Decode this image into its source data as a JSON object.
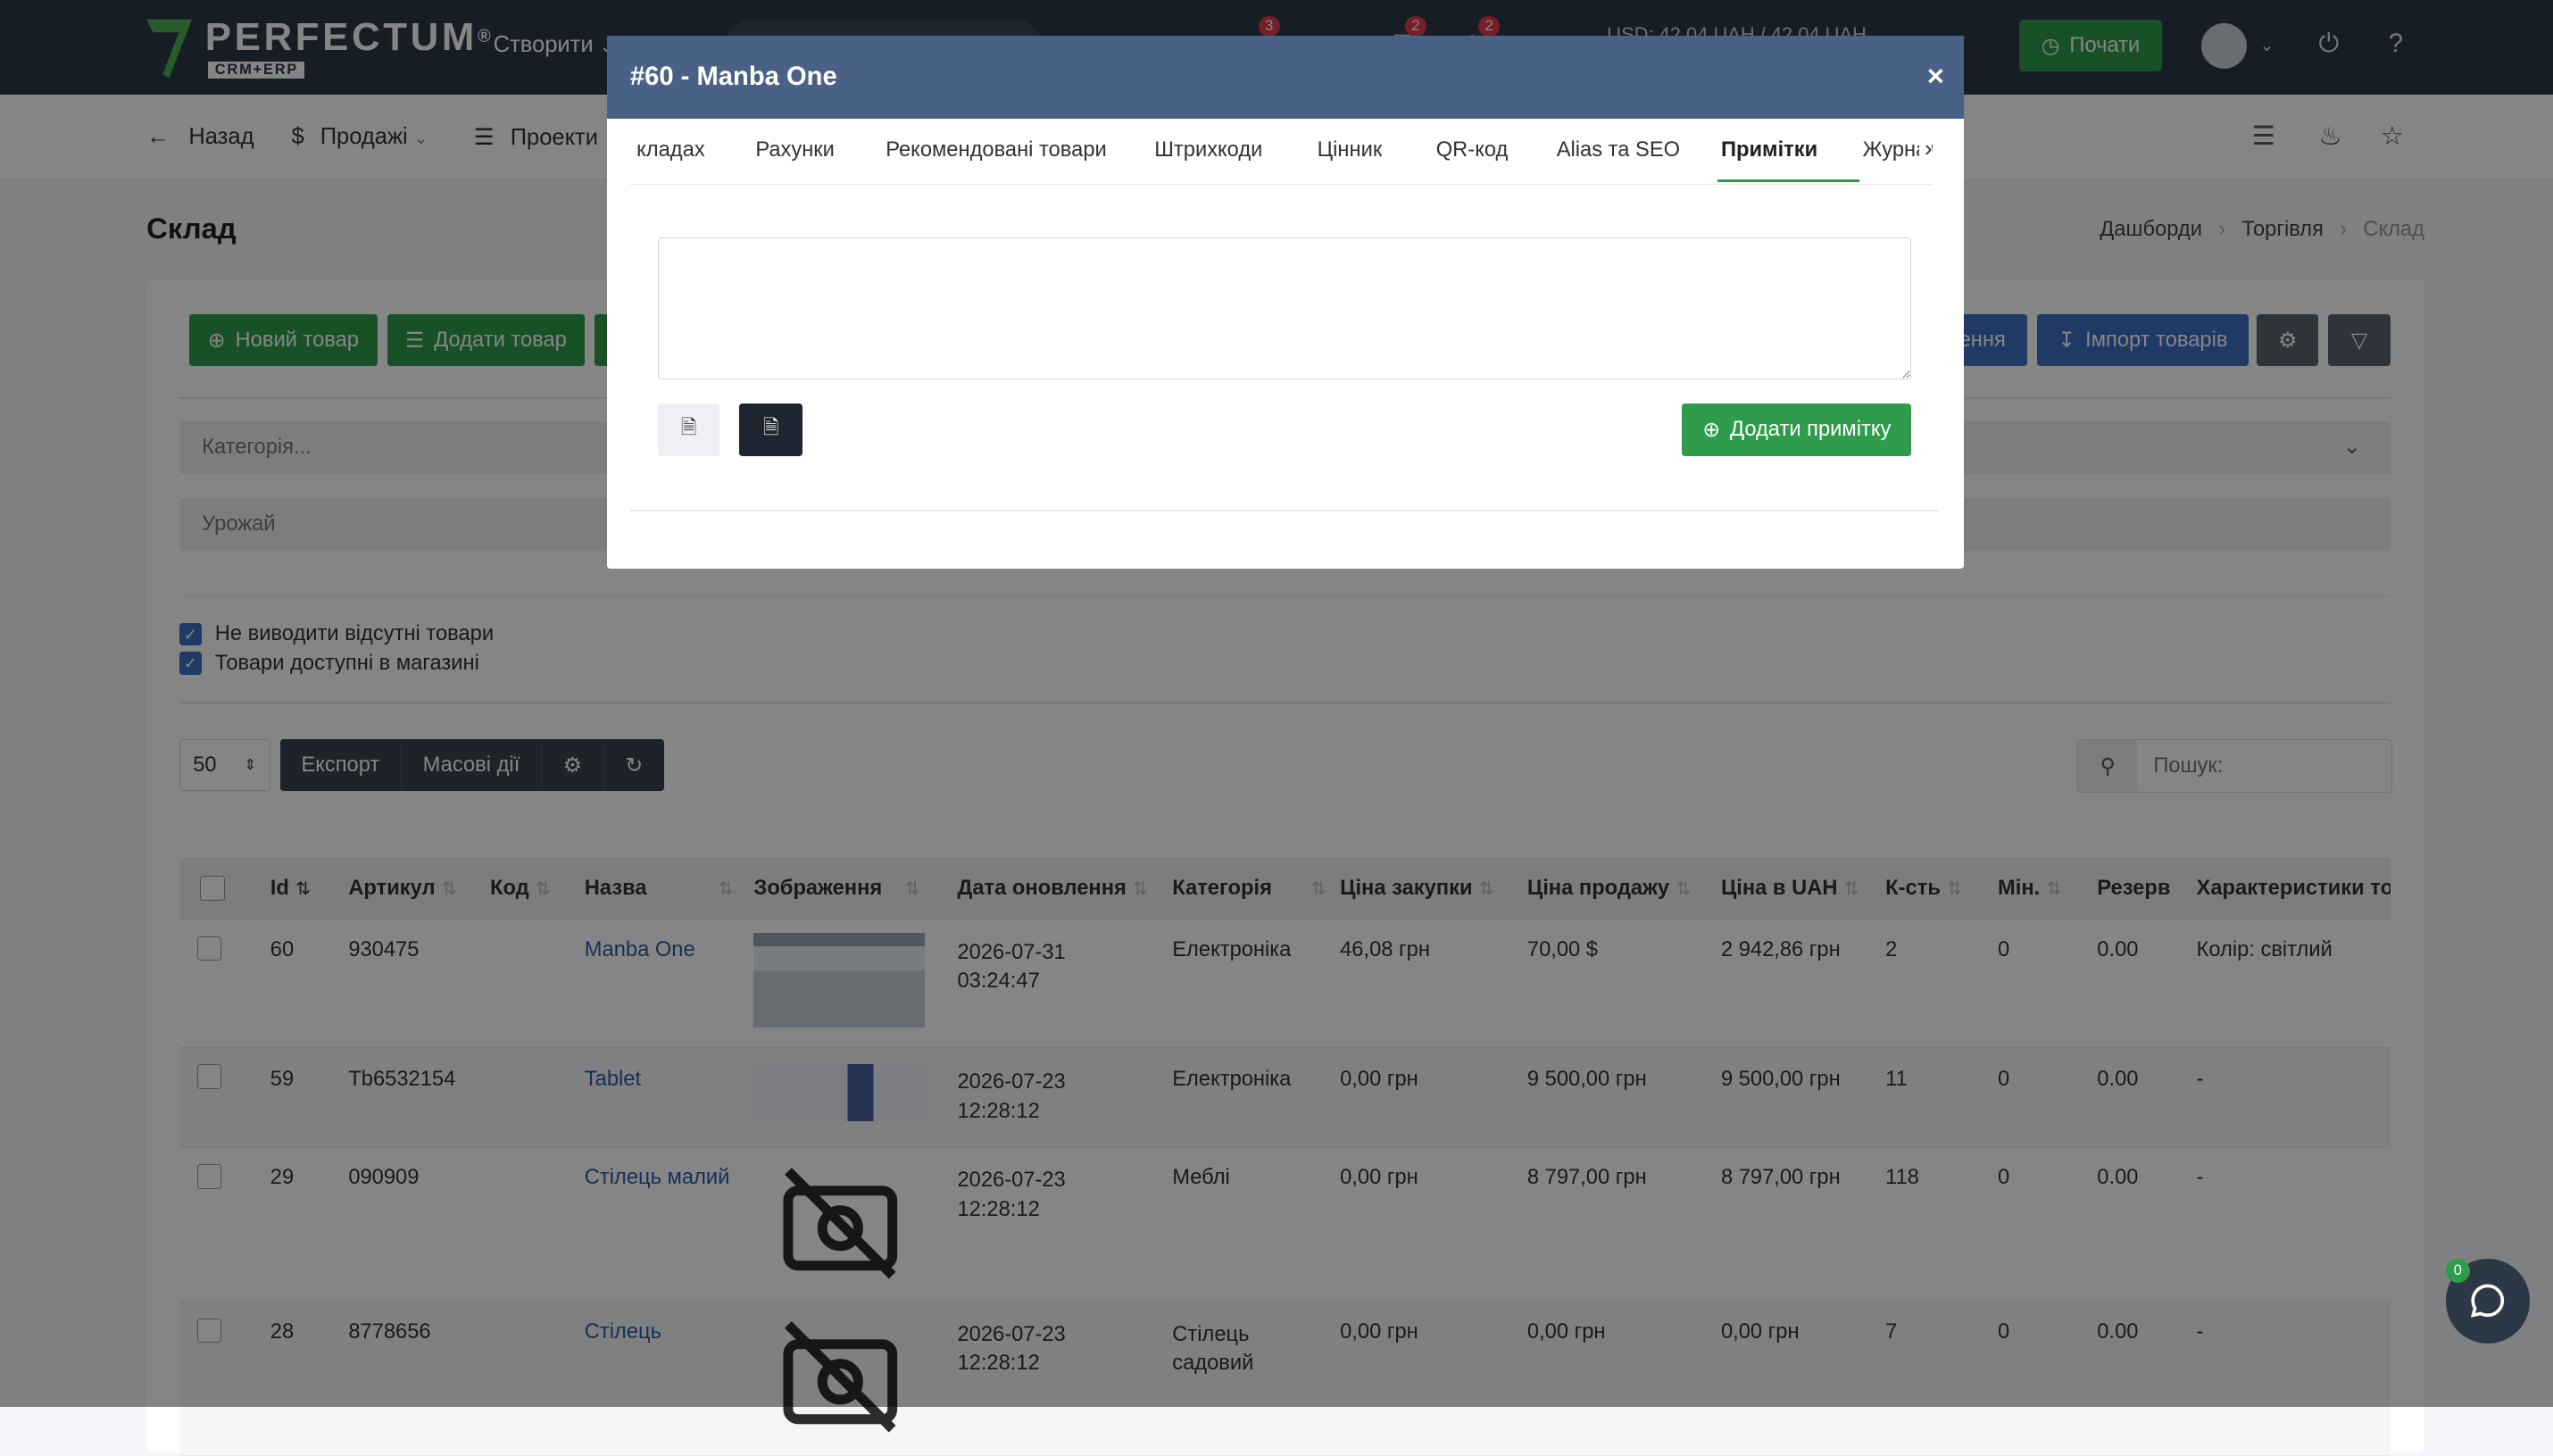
{
  "header": {
    "logo": "PERFECTUM",
    "logo_reg": "®",
    "logo_sub": "CRM+ERP",
    "create_menu": "Створити",
    "rates": "USD: 42,04 UAH / 42,04 UAH",
    "badges": [
      "3",
      "2",
      "2"
    ],
    "start_button": "Почати"
  },
  "subnav": {
    "back": "Назад",
    "sales": "Продажі",
    "projects": "Проекти"
  },
  "page": {
    "title": "Склад",
    "breadcrumb": [
      "Дашборди",
      "Торгівля",
      "Склад"
    ]
  },
  "actions": {
    "new_product": "Новий товар",
    "add_product": "Додати товар",
    "update_partial": "ення",
    "import_products": "Імпорт товарів"
  },
  "filters": {
    "category_placeholder": "Категорія...",
    "harvest_placeholder": "Урожай",
    "hide_missing": "Не виводити відсутні товари",
    "available_in_store": "Товари доступні в магазині"
  },
  "toolbar": {
    "per_page": "50",
    "export": "Експорт",
    "bulk_actions": "Масові дії",
    "search_placeholder": "Пошук:"
  },
  "table": {
    "columns": [
      "Id",
      "Артикул",
      "Код",
      "Назва",
      "Зображення",
      "Дата оновлення",
      "Категорія",
      "Ціна закупки",
      "Ціна продажу",
      "Ціна в UAH",
      "К-сть",
      "Мін.",
      "Резерв",
      "Характеристики тов"
    ],
    "rows": [
      {
        "id": "60",
        "sku": "930475",
        "code": "",
        "name": "Manba One",
        "date": "2026-07-31",
        "time": "03:24:47",
        "category": "Електроніка",
        "category2": "",
        "purchase": "46,08 грн",
        "sale": "70,00 $",
        "uah": "2 942,86 грн",
        "qty": "2",
        "min": "0",
        "reserve": "0.00",
        "chars": "Колір: світлий"
      },
      {
        "id": "59",
        "sku": "Tb6532154",
        "code": "",
        "name": "Tablet",
        "date": "2026-07-23",
        "time": "12:28:12",
        "category": "Електроніка",
        "category2": "",
        "purchase": "0,00 грн",
        "sale": "9 500,00 грн",
        "uah": "9 500,00 грн",
        "qty": "11",
        "min": "0",
        "reserve": "0.00",
        "chars": "-"
      },
      {
        "id": "29",
        "sku": "090909",
        "code": "",
        "name": "Стілець малий",
        "date": "2026-07-23",
        "time": "12:28:12",
        "category": "Меблі",
        "category2": "",
        "purchase": "0,00 грн",
        "sale": "8 797,00 грн",
        "uah": "8 797,00 грн",
        "qty": "118",
        "min": "0",
        "reserve": "0.00",
        "chars": "-"
      },
      {
        "id": "28",
        "sku": "8778656",
        "code": "",
        "name": "Стілець",
        "date": "2026-07-23",
        "time": "12:28:12",
        "category": "Стілець",
        "category2": "садовий",
        "purchase": "0,00 грн",
        "sale": "0,00 грн",
        "uah": "0,00 грн",
        "qty": "7",
        "min": "0",
        "reserve": "0.00",
        "chars": "-"
      }
    ]
  },
  "modal": {
    "title": "#60 - Manba One",
    "close": "×",
    "tabs": [
      "кладах",
      "Рахунки",
      "Рекомендовані товари",
      "Штрихкоди",
      "Цінник",
      "QR-код",
      "Alias та SEO",
      "Примітки",
      "Журнал"
    ],
    "active_tab": "Примітки",
    "add_note": "Додати примітку"
  },
  "chat": {
    "count": "0"
  },
  "colors": {
    "header": "#2d3846",
    "green": "#2e9c4a",
    "blue": "#3d6fc1",
    "modal_head": "#4a6186"
  }
}
